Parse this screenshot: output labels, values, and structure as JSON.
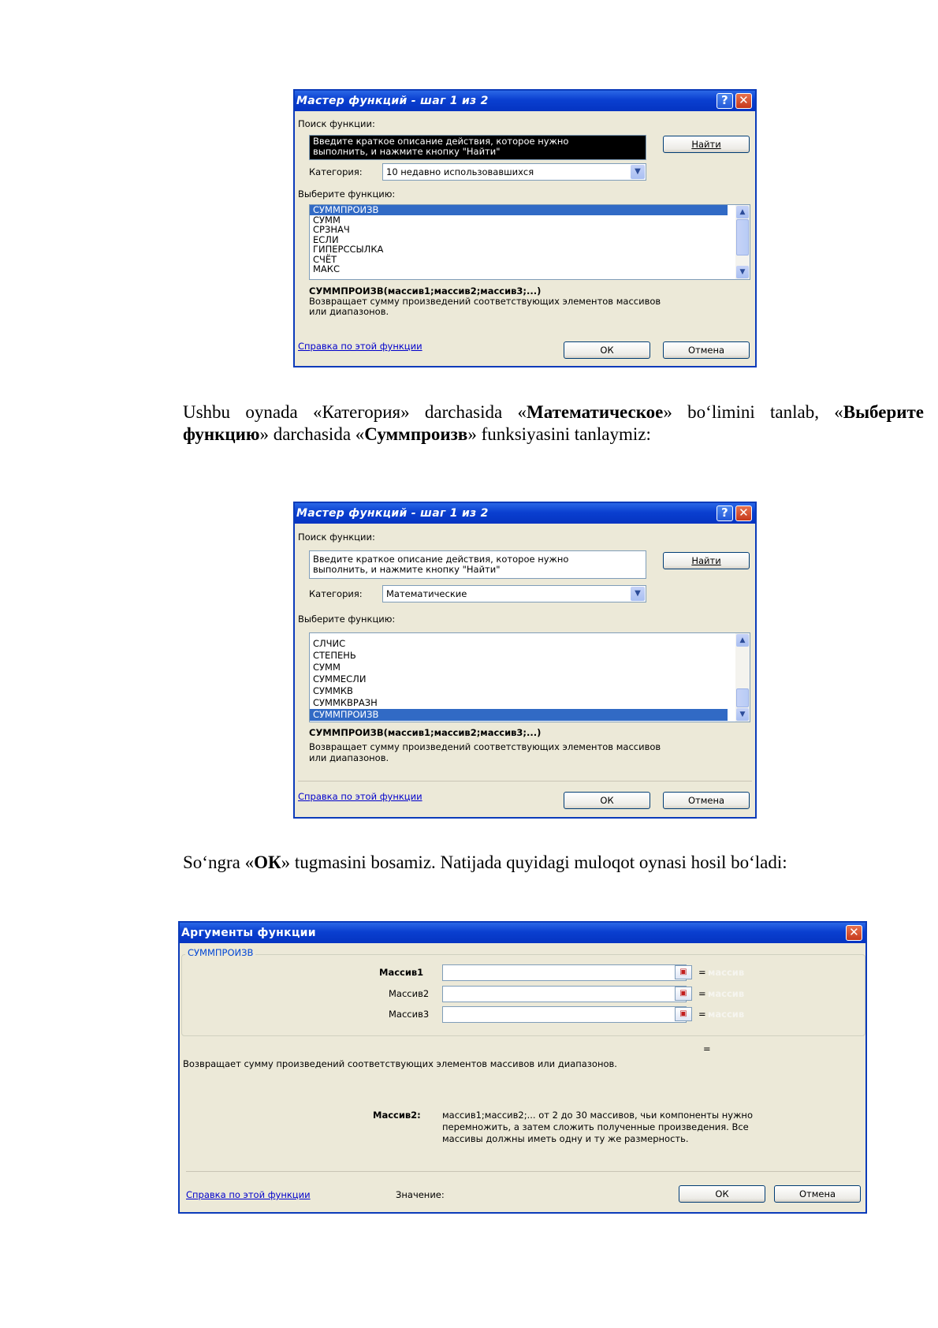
{
  "dialog1": {
    "title": "Мастер функций - шаг 1 из 2",
    "help_glyph": "?",
    "close_glyph": "✕",
    "search_label": "Поиск функции:",
    "search_text": "Введите краткое описание действия, которое нужно\nвыполнить, и нажмите кнопку \"Найти\"",
    "find_button": "Найти",
    "category_label": "Категория:",
    "category_value": "10 недавно использовавшихся",
    "select_label": "Выберите функцию:",
    "functions": [
      "СУММПРОИЗВ",
      "СУММ",
      "СРЗНАЧ",
      "ЕСЛИ",
      "ГИПЕРССЫЛКА",
      "СЧЁТ",
      "МАКС"
    ],
    "selected_index": 0,
    "signature": "СУММПРОИЗВ(массив1;массив2;массив3;...)",
    "description": "Возвращает сумму произведений соответствующих элементов массивов\nили диапазонов.",
    "help_link": "Справка по этой функции",
    "ok_button": "ОК",
    "cancel_button": "Отмена"
  },
  "paragraph1": {
    "t1": "Ushbu oynada «Категория» darchasida «",
    "b1": "Математическое",
    "t2": "» bo‘limini tanlab, «",
    "b2": "Выберите функцию",
    "t3": "» darchasida «",
    "b3": "Суммпроизв",
    "t4": "» funksiyasini tanlaymiz:"
  },
  "dialog2": {
    "title": "Мастер функций - шаг 1 из 2",
    "help_glyph": "?",
    "close_glyph": "✕",
    "search_label": "Поиск функции:",
    "search_text": "Введите краткое описание действия, которое нужно\nвыполнить, и нажмите кнопку \"Найти\"",
    "find_button": "Найти",
    "category_label": "Категория:",
    "category_value": "Математические",
    "select_label": "Выберите функцию:",
    "functions": [
      "СЛЧИС",
      "СТЕПЕНЬ",
      "СУММ",
      "СУММЕСЛИ",
      "СУММКВ",
      "СУММКВРАЗН",
      "СУММПРОИЗВ"
    ],
    "selected_index": 6,
    "signature": "СУММПРОИЗВ(массив1;массив2;массив3;...)",
    "description": "Возвращает сумму произведений соответствующих элементов массивов\nили диапазонов.",
    "help_link": "Справка по этой функции",
    "ok_button": "ОК",
    "cancel_button": "Отмена"
  },
  "paragraph2": {
    "t1": "So‘ngra «",
    "b1": "ОК",
    "t2": "» tugmasini bosamiz.  Natijada quyidagi muloqot oynasi hosil bo‘ladi:"
  },
  "dialog3": {
    "title": "Аргументы функции",
    "close_glyph": "✕",
    "group_label": "СУММПРОИЗВ",
    "args": [
      {
        "label": "Массив1",
        "bold": true,
        "eq": "=",
        "hint": "массив"
      },
      {
        "label": "Массив2",
        "bold": false,
        "eq": "=",
        "hint": "массив"
      },
      {
        "label": "Массив3",
        "bold": false,
        "eq": "=",
        "hint": "массив"
      }
    ],
    "result_eq": "=",
    "description": "Возвращает сумму произведений соответствующих элементов массивов или диапазонов.",
    "arg_name": "Массив2:",
    "arg_help": "массив1;массив2;... от 2 до 30 массивов, чьи компоненты нужно\nперемножить, а затем сложить полученные произведения. Все\nмассивы должны иметь одну и ту же размерность.",
    "help_link": "Справка по этой функции",
    "value_label": "Значение:",
    "ok_button": "ОК",
    "cancel_button": "Отмена"
  }
}
